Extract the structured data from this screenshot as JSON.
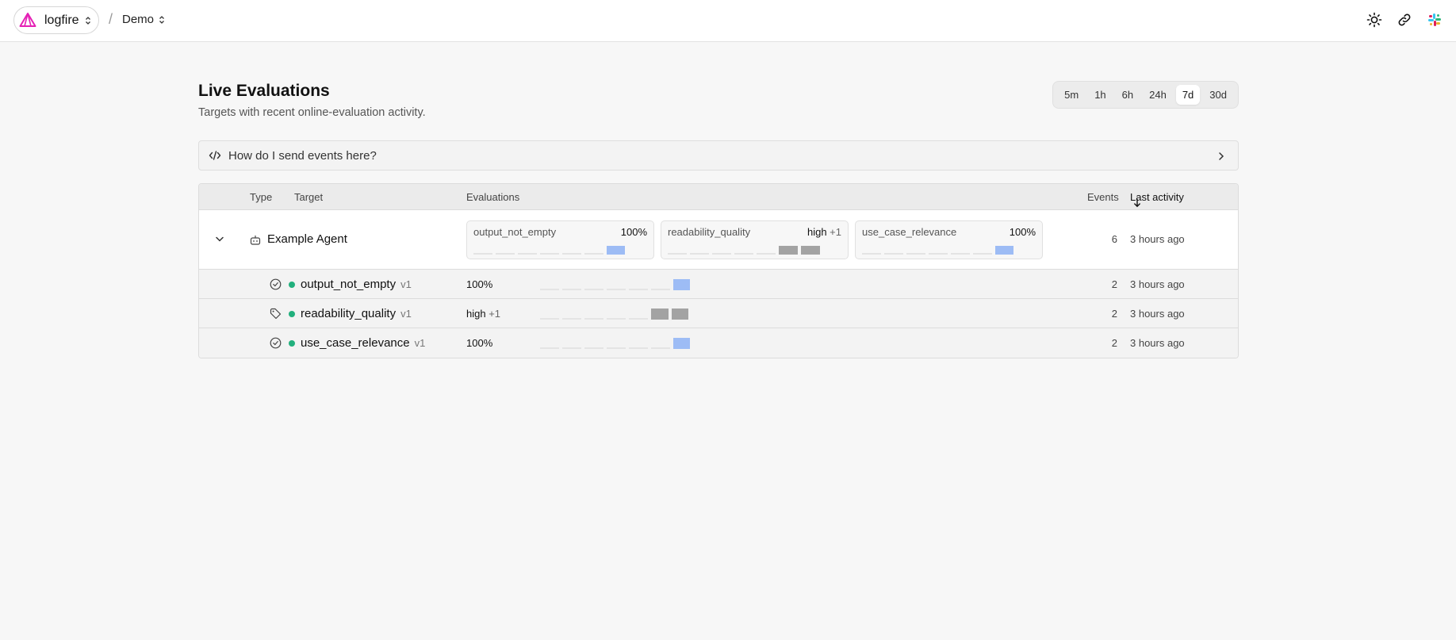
{
  "topbar": {
    "org_name": "logfire",
    "separator": "/",
    "project_name": "Demo",
    "icons": [
      "theme-sun-icon",
      "link-icon",
      "slack-icon"
    ]
  },
  "page": {
    "title": "Live Evaluations",
    "subtitle": "Targets with recent online-evaluation activity."
  },
  "time_ranges": {
    "options": [
      "5m",
      "1h",
      "6h",
      "24h",
      "7d",
      "30d"
    ],
    "selected": "7d"
  },
  "help": {
    "text": "How do I send events here?"
  },
  "table": {
    "headers": {
      "type": "Type",
      "target": "Target",
      "evaluations": "Evaluations",
      "events": "Events",
      "last_activity": "Last activity"
    },
    "parent": {
      "name": "Example Agent",
      "events": "6",
      "last_activity": "3 hours ago",
      "cards": [
        {
          "name": "output_not_empty",
          "value": "100%",
          "extra": ""
        },
        {
          "name": "readability_quality",
          "value": "high",
          "extra": "+1"
        },
        {
          "name": "use_case_relevance",
          "value": "100%",
          "extra": ""
        }
      ]
    },
    "children": [
      {
        "icon": "check-circle-icon",
        "name": "output_not_empty",
        "version": "v1",
        "value": "100%",
        "extra": "",
        "events": "2",
        "last_activity": "3 hours ago"
      },
      {
        "icon": "tag-icon",
        "name": "readability_quality",
        "version": "v1",
        "value": "high",
        "extra": "+1",
        "events": "2",
        "last_activity": "3 hours ago"
      },
      {
        "icon": "check-circle-icon",
        "name": "use_case_relevance",
        "version": "v1",
        "value": "100%",
        "extra": "",
        "events": "2",
        "last_activity": "3 hours ago"
      }
    ]
  },
  "colors": {
    "brand_pink": "#e520b5",
    "status_green": "#22b07d",
    "spark_blue": "#9dbcf5",
    "spark_gray": "#a3a3a3"
  }
}
